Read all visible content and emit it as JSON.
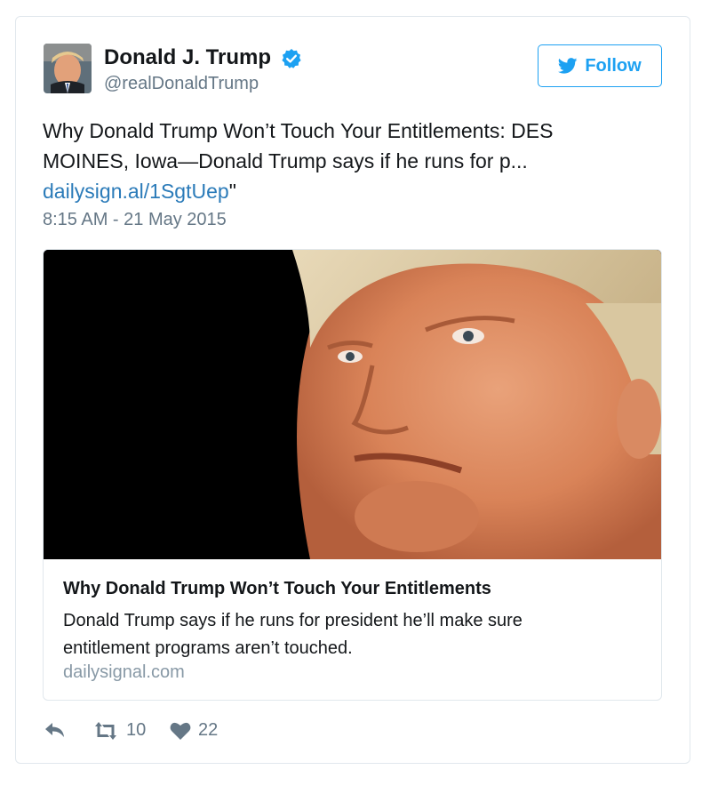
{
  "author": {
    "name": "Donald J. Trump",
    "handle": "@realDonaldTrump",
    "verified": true
  },
  "follow_button": {
    "label": "Follow",
    "icon": "twitter-bird-icon",
    "color": "#1da1f2"
  },
  "tweet": {
    "text_line1": "Why Donald Trump Won’t Touch Your Entitlements: DES",
    "text_line2": "MOINES, Iowa—Donald Trump says if he runs for p...",
    "link": "dailysign.al/1SgtUep",
    "link_suffix": "\"",
    "timestamp": "8:15 AM - 21 May 2015"
  },
  "link_card": {
    "title": "Why Donald Trump Won’t Touch Your Entitlements",
    "description": "Donald Trump says if he runs for president he’ll make sure entitlement programs aren’t touched.",
    "domain": "dailysignal.com"
  },
  "actions": {
    "reply_icon": "reply-icon",
    "retweet_icon": "retweet-icon",
    "retweet_count": "10",
    "like_icon": "heart-icon",
    "like_count": "22"
  },
  "colors": {
    "link": "#2b7bb9",
    "muted": "#657786",
    "border": "#e1e8ed"
  }
}
